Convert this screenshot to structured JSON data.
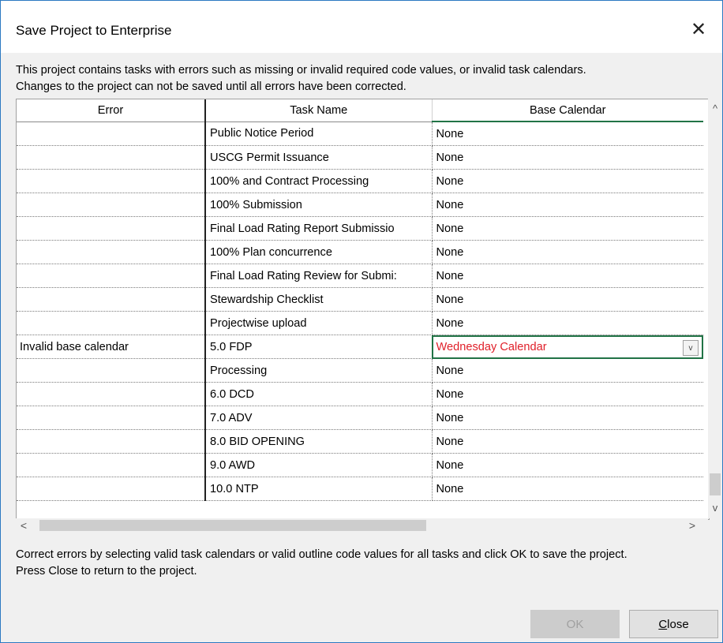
{
  "dialog": {
    "title": "Save Project to Enterprise",
    "close_glyph": "✕",
    "message_line1": "This project contains tasks with errors such as missing or invalid required code values, or invalid task calendars.",
    "message_line2": "Changes to the project can not be saved until all errors have been corrected.",
    "instructions_line1": "Correct errors by selecting valid task calendars or valid outline code values for all tasks and click OK to save the project.",
    "instructions_line2": "Press Close to return to the project."
  },
  "grid": {
    "columns": [
      "Error",
      "Task Name",
      "Base Calendar"
    ],
    "rows": [
      {
        "error": "",
        "task": "Public Notice Period",
        "calendar": "None"
      },
      {
        "error": "",
        "task": "USCG Permit Issuance",
        "calendar": "None"
      },
      {
        "error": "",
        "task": " 100% and Contract Processing",
        "calendar": "None"
      },
      {
        "error": "",
        "task": "100% Submission",
        "calendar": "None"
      },
      {
        "error": "",
        "task": "Final Load Rating Report Submissio",
        "calendar": "None"
      },
      {
        "error": "",
        "task": "100% Plan concurrence",
        "calendar": "None"
      },
      {
        "error": "",
        "task": "Final Load Rating Review for Submi:",
        "calendar": "None"
      },
      {
        "error": "",
        "task": "Stewardship Checklist",
        "calendar": "None"
      },
      {
        "error": "",
        "task": "Projectwise upload",
        "calendar": "None"
      },
      {
        "error": "Invalid base calendar",
        "task": "5.0 FDP",
        "calendar": "Wednesday Calendar"
      },
      {
        "error": "",
        "task": "Processing",
        "calendar": "None"
      },
      {
        "error": "",
        "task": "6.0 DCD",
        "calendar": "None"
      },
      {
        "error": "",
        "task": "7.0 ADV",
        "calendar": "None"
      },
      {
        "error": "",
        "task": "8.0 BID OPENING",
        "calendar": "None"
      },
      {
        "error": "",
        "task": "9.0 AWD",
        "calendar": "None"
      },
      {
        "error": "",
        "task": "10.0 NTP",
        "calendar": "None"
      }
    ],
    "error_color": "#e0202a",
    "selection_color": "#217346"
  },
  "buttons": {
    "ok": "OK",
    "close_prefix": "C",
    "close_rest": "lose"
  },
  "icons": {
    "scroll_up": "^",
    "scroll_down": "v",
    "scroll_left": "<",
    "scroll_right": ">",
    "dropdown": "v"
  }
}
